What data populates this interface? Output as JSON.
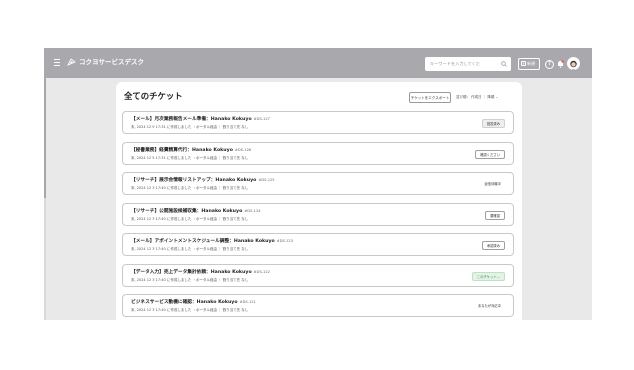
{
  "header": {
    "app_title": "コクヨサービスデスク",
    "search_placeholder": "キーワードを入力してくだ",
    "new_button_label": "新規",
    "help_label": "?"
  },
  "panel": {
    "title": "全てのチケット",
    "export_label": "チケットをエクスポート",
    "sort_label": "並び順： 作成日 ｜ 降順 ⌄"
  },
  "tickets": [
    {
      "category": "【メール】",
      "title": "月次業務報告メール準備",
      "assignee": "Hanako Kokuyo",
      "id": "#DS-127",
      "meta": "末, 2024 12 9 17:31 に作成しました ・ポータル経由 ｜ 割り当て先 なし",
      "status": "回答済み",
      "status_style": "gray"
    },
    {
      "category": "【秘書業務】",
      "title": "経費精算代行",
      "assignee": "Hanako Kokuyo",
      "id": "#DS-126",
      "meta": "末, 2024 12 5 17:31 に作成しました ・ポータル経由 ｜ 割り当て先 なし",
      "status": "確認ください",
      "status_style": "outline"
    },
    {
      "category": "【リサーチ】",
      "title": "展示会情報リストアップ",
      "assignee": "Hanako Kokuyo",
      "id": "#DS-125",
      "meta": "末, 2024 12 3 17:40 に作成しました ・ポータル経由 ｜ 割り当て先 なし",
      "status": "返信待機中",
      "status_style": "plain"
    },
    {
      "category": "【リサーチ】",
      "title": "公開施設候補収集",
      "assignee": "Hanako Kokuyo",
      "id": "#DS-124",
      "meta": "末, 2024 12 3 17:40 に作成しました ・ポータル経由 ｜ 割り当て先 なし",
      "status": "要確認",
      "status_style": "outline"
    },
    {
      "category": "【メール】",
      "title": "アポイントメントスケジュール調整",
      "assignee": "Hanako Kokuyo",
      "id": "#DS-123",
      "meta": "末, 2024 12 3 17:40 に作成しました ・ポータル経由 ｜ 割り当て先 なし",
      "status": "承認済み",
      "status_style": "outline"
    },
    {
      "category": "【データ入力】",
      "title": "売上データ集計依頼",
      "assignee": "Hanako Kokuyo",
      "id": "#DS-122",
      "meta": "末, 2024 12 3 17:40 に作成しました ・ポータル経由 ｜ 割り当て先 なし",
      "status": "このチケット…",
      "status_style": "green"
    },
    {
      "category": "",
      "title": "ビジネスサービス動機に確認",
      "assignee": "Hanako Kokuyo",
      "id": "#DS-121",
      "meta": "末, 2024 12 3 17:40 に作成しました ・ポータル経由 ｜ 割り当て先 なし",
      "status": "あなたが対応中",
      "status_style": "plain"
    }
  ],
  "colors": {
    "topbar": "#a9a8ac",
    "background": "#e9e9ea",
    "card_border": "#c9c9c9"
  }
}
